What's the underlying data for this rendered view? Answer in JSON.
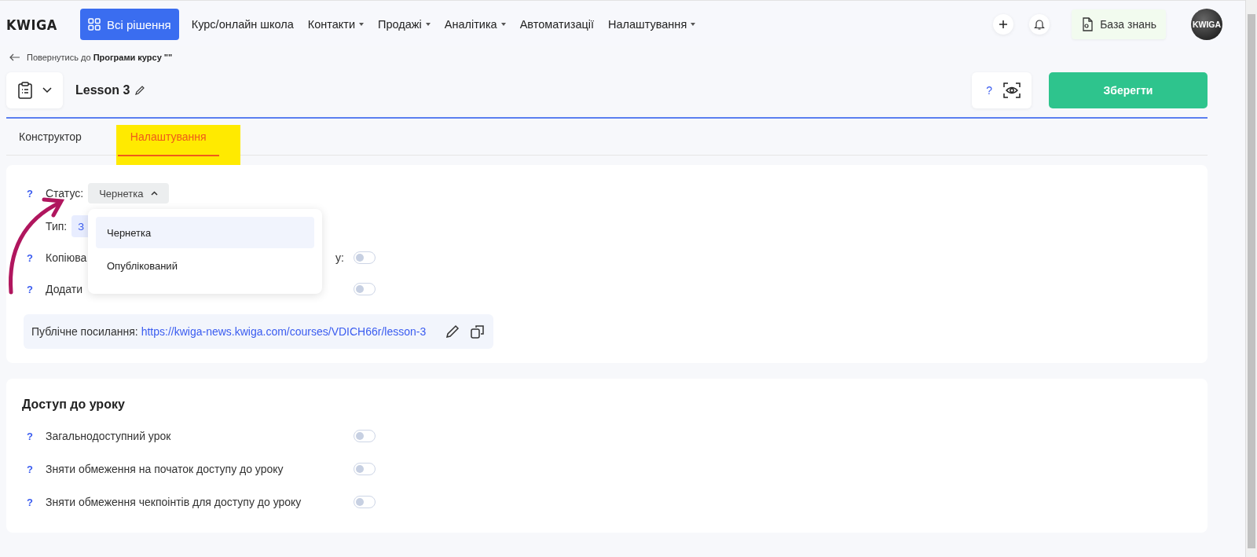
{
  "nav": {
    "logo": "KWIGA",
    "solutions_button": "Всі рішення",
    "items": [
      {
        "label": "Курс/онлайн школа",
        "has_menu": false
      },
      {
        "label": "Контакти",
        "has_menu": true
      },
      {
        "label": "Продажі",
        "has_menu": true
      },
      {
        "label": "Аналітика",
        "has_menu": true
      },
      {
        "label": "Автоматизації",
        "has_menu": false
      },
      {
        "label": "Налаштування",
        "has_menu": true
      }
    ],
    "knowledge_button": "База знань",
    "avatar": "KWIGA"
  },
  "back_link": "Повернутись до **Програми курсу \"\"**",
  "header": {
    "title": "Lesson 3",
    "help": "?",
    "save_button": "Зберегти"
  },
  "tabs": [
    {
      "label": "Конструктор",
      "selected": false
    },
    {
      "label": "Налаштування",
      "selected": true
    }
  ],
  "settings": {
    "status": {
      "help": "?",
      "label": "Статус:",
      "value": "Чернетка",
      "expanded": true,
      "options": [
        {
          "label": "Чернетка",
          "selected": true
        },
        {
          "label": "Опублікований",
          "selected": false
        }
      ]
    },
    "rows": [
      {
        "kind": "tag",
        "label": "Тип:",
        "tag": "З"
      },
      {
        "kind": "toggle",
        "help": "?",
        "label": "Копіюва",
        "label_tail": "у:",
        "on": false
      },
      {
        "kind": "toggle",
        "help": "?",
        "label": "Додати",
        "on": false
      }
    ],
    "public_link": {
      "label": "Публічне посилання:",
      "url": "https://kwiga-news.kwiga.com/courses/VDICH66r/lesson-3"
    }
  },
  "access": {
    "title": "Доступ до уроку",
    "rows": [
      {
        "help": "?",
        "label": "Загальнодоступний урок",
        "on": false
      },
      {
        "help": "?",
        "label": "Зняти обмеження на початок доступу до уроку",
        "on": false
      },
      {
        "help": "?",
        "label": "Зняти обмеження чекпоінтів для доступу до уроку",
        "on": false
      }
    ]
  }
}
